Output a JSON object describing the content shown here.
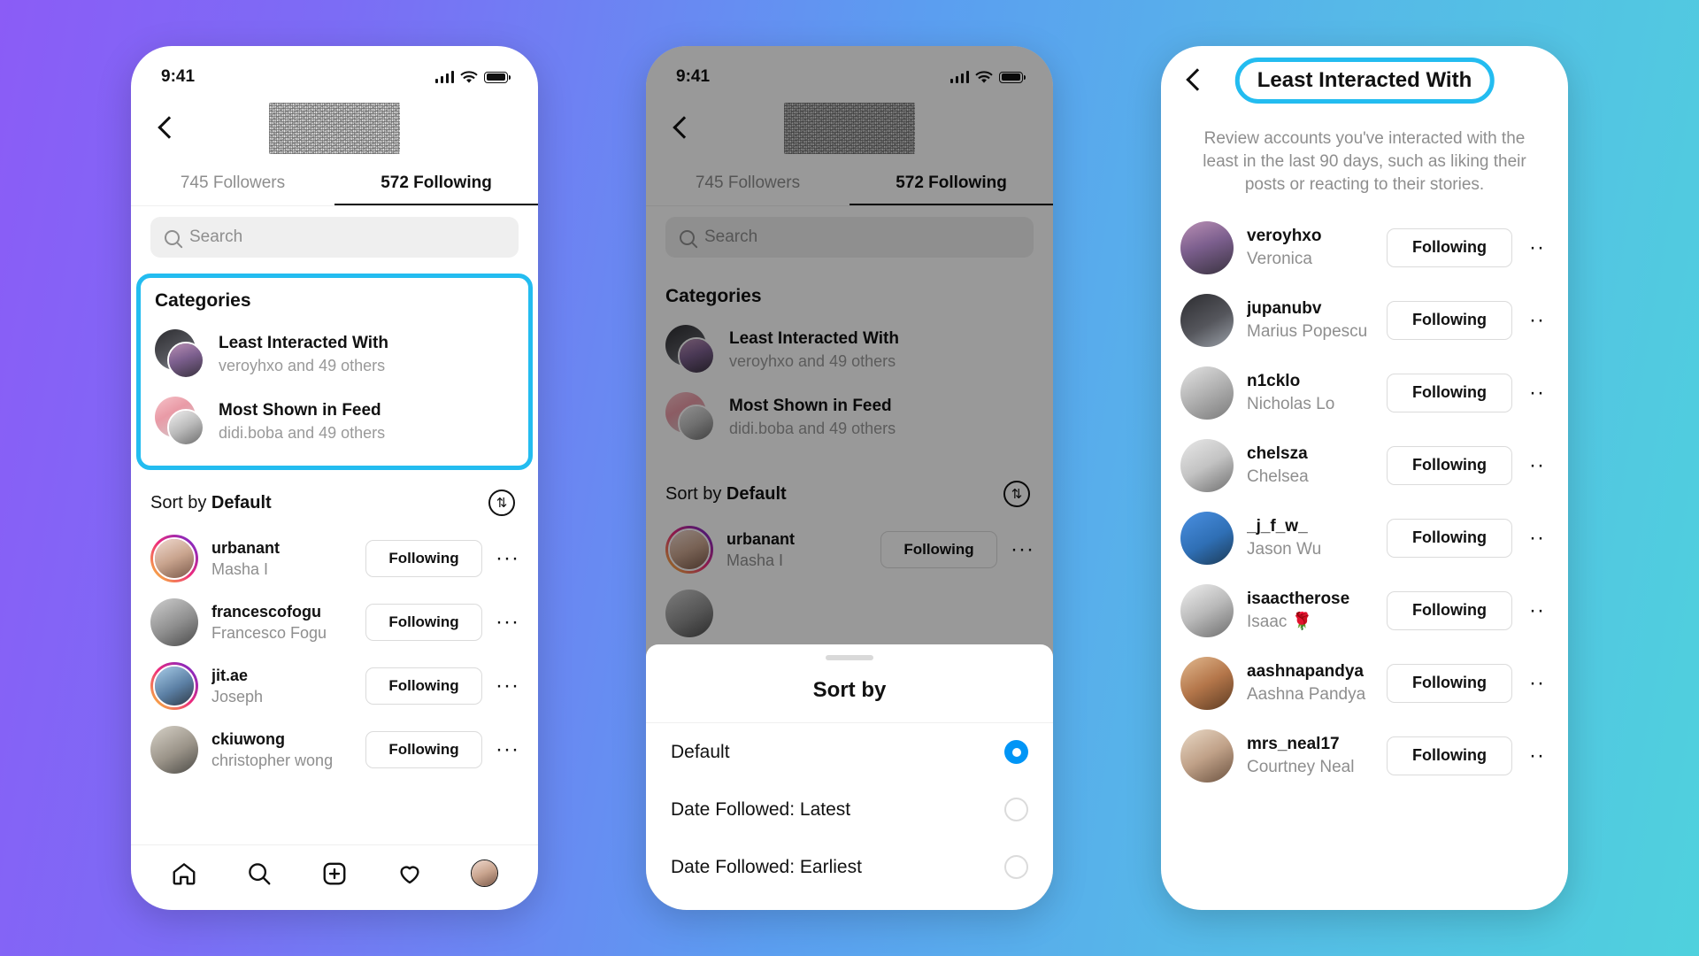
{
  "theme": {
    "highlight_color": "#23bcf0",
    "accent_blue": "#0095f6",
    "background_gradient_from": "#8b5cf6",
    "background_gradient_to": "#4fd1dd"
  },
  "phone1": {
    "status": {
      "time": "9:41"
    },
    "tabs": [
      {
        "label": "745 Followers",
        "active": false
      },
      {
        "label": "572 Following",
        "active": true
      }
    ],
    "search": {
      "placeholder": "Search"
    },
    "categories": {
      "title": "Categories",
      "items": [
        {
          "title": "Least Interacted With",
          "subtitle": "veroyhxo and 49 others"
        },
        {
          "title": "Most Shown in Feed",
          "subtitle": "didi.boba and 49 others"
        }
      ]
    },
    "sort": {
      "prefix": "Sort by",
      "value": "Default",
      "icon": "sort-arrows-icon"
    },
    "users": [
      {
        "username": "urbanant",
        "name": "Masha I",
        "action": "Following",
        "ring": true
      },
      {
        "username": "francescofogu",
        "name": "Francesco Fogu",
        "action": "Following",
        "ring": false
      },
      {
        "username": "jit.ae",
        "name": "Joseph",
        "action": "Following",
        "ring": true
      },
      {
        "username": "ckiuwong",
        "name": "christopher wong",
        "action": "Following",
        "ring": false
      }
    ],
    "bottom_nav": [
      "home-icon",
      "search-icon",
      "create-icon",
      "heart-icon",
      "profile-avatar"
    ]
  },
  "phone2": {
    "status": {
      "time": "9:41"
    },
    "tabs": [
      {
        "label": "745 Followers",
        "active": false
      },
      {
        "label": "572 Following",
        "active": true
      }
    ],
    "search": {
      "placeholder": "Search"
    },
    "categories": {
      "title": "Categories",
      "items": [
        {
          "title": "Least Interacted With",
          "subtitle": "veroyhxo and 49 others"
        },
        {
          "title": "Most Shown in Feed",
          "subtitle": "didi.boba and 49 others"
        }
      ]
    },
    "sort": {
      "prefix": "Sort by",
      "value": "Default",
      "icon": "sort-arrows-icon"
    },
    "users": [
      {
        "username": "urbanant",
        "name": "Masha I",
        "action": "Following",
        "ring": true
      }
    ],
    "sheet": {
      "title": "Sort by",
      "options": [
        {
          "label": "Default",
          "selected": true
        },
        {
          "label": "Date Followed: Latest",
          "selected": false
        },
        {
          "label": "Date Followed: Earliest",
          "selected": false
        }
      ]
    }
  },
  "phone3": {
    "title": "Least Interacted With",
    "description": "Review accounts you've interacted with the least in the last 90 days, such as liking their posts or reacting to their stories.",
    "users": [
      {
        "username": "veroyhxo",
        "name": "Veronica",
        "action": "Following"
      },
      {
        "username": "jupanubv",
        "name": "Marius Popescu",
        "action": "Following"
      },
      {
        "username": "n1cklo",
        "name": "Nicholas Lo",
        "action": "Following"
      },
      {
        "username": "chelsza",
        "name": "Chelsea",
        "action": "Following"
      },
      {
        "username": "_j_f_w_",
        "name": "Jason Wu",
        "action": "Following"
      },
      {
        "username": "isaactherose",
        "name": "Isaac 🌹",
        "action": "Following"
      },
      {
        "username": "aashnapandya",
        "name": "Aashna Pandya",
        "action": "Following"
      },
      {
        "username": "mrs_neal17",
        "name": "Courtney Neal",
        "action": "Following"
      }
    ]
  }
}
